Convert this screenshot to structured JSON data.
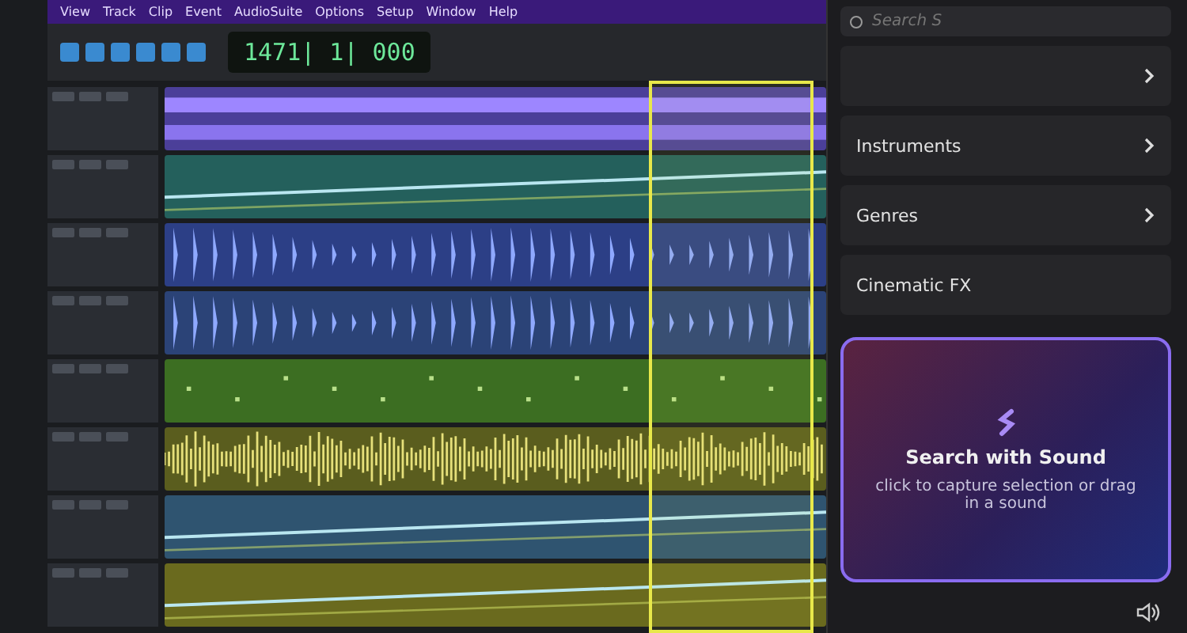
{
  "menu": [
    "View",
    "Track",
    "Clip",
    "Event",
    "AudioSuite",
    "Options",
    "Setup",
    "Window",
    "Help"
  ],
  "counter": "1471| 1| 000",
  "tracks": [
    {
      "kind": "bars",
      "color": "#4b3f99"
    },
    {
      "kind": "line",
      "color": "#24605c"
    },
    {
      "kind": "spikes",
      "color": "#2c3f86"
    },
    {
      "kind": "spikes",
      "color": "#2b4377"
    },
    {
      "kind": "dots",
      "color": "#3c6e22"
    },
    {
      "kind": "dense",
      "color": "#5a5d1e"
    },
    {
      "kind": "line",
      "color": "#2f5470"
    },
    {
      "kind": "line",
      "color": "#6a6a1e"
    }
  ],
  "panel": {
    "search": {
      "placeholder": "Search S"
    },
    "categories": [
      {
        "expandable": true
      },
      {
        "label": "Instruments",
        "expandable": true
      },
      {
        "label": "Genres",
        "expandable": true
      },
      {
        "label": "Cinematic FX",
        "expandable": false
      }
    ],
    "card": {
      "title": "Search with Sound",
      "hint": "click to capture selection or drag in a sound"
    }
  }
}
